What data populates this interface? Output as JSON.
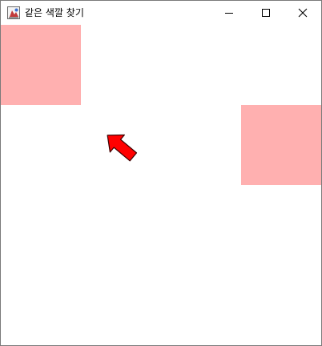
{
  "window": {
    "title": "같은 색깔 찾기",
    "controls": {
      "minimize": "minimize-icon",
      "maximize": "maximize-icon",
      "close": "close-icon"
    }
  },
  "game": {
    "tile_color": "#ffb0b0",
    "tiles": [
      {
        "name": "tile-top-left"
      },
      {
        "name": "tile-right"
      }
    ],
    "pointer": {
      "icon": "arrow-icon",
      "color": "#ff0000",
      "direction": "up-left"
    }
  }
}
